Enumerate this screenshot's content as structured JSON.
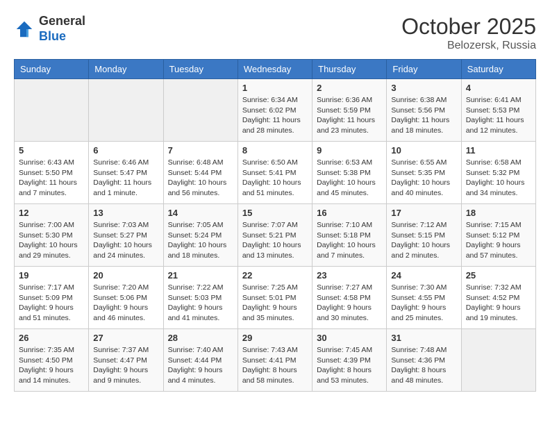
{
  "header": {
    "logo_general": "General",
    "logo_blue": "Blue",
    "title": "October 2025",
    "subtitle": "Belozersk, Russia"
  },
  "weekdays": [
    "Sunday",
    "Monday",
    "Tuesday",
    "Wednesday",
    "Thursday",
    "Friday",
    "Saturday"
  ],
  "weeks": [
    [
      {
        "day": "",
        "info": ""
      },
      {
        "day": "",
        "info": ""
      },
      {
        "day": "",
        "info": ""
      },
      {
        "day": "1",
        "info": "Sunrise: 6:34 AM\nSunset: 6:02 PM\nDaylight: 11 hours and 28 minutes."
      },
      {
        "day": "2",
        "info": "Sunrise: 6:36 AM\nSunset: 5:59 PM\nDaylight: 11 hours and 23 minutes."
      },
      {
        "day": "3",
        "info": "Sunrise: 6:38 AM\nSunset: 5:56 PM\nDaylight: 11 hours and 18 minutes."
      },
      {
        "day": "4",
        "info": "Sunrise: 6:41 AM\nSunset: 5:53 PM\nDaylight: 11 hours and 12 minutes."
      }
    ],
    [
      {
        "day": "5",
        "info": "Sunrise: 6:43 AM\nSunset: 5:50 PM\nDaylight: 11 hours and 7 minutes."
      },
      {
        "day": "6",
        "info": "Sunrise: 6:46 AM\nSunset: 5:47 PM\nDaylight: 11 hours and 1 minute."
      },
      {
        "day": "7",
        "info": "Sunrise: 6:48 AM\nSunset: 5:44 PM\nDaylight: 10 hours and 56 minutes."
      },
      {
        "day": "8",
        "info": "Sunrise: 6:50 AM\nSunset: 5:41 PM\nDaylight: 10 hours and 51 minutes."
      },
      {
        "day": "9",
        "info": "Sunrise: 6:53 AM\nSunset: 5:38 PM\nDaylight: 10 hours and 45 minutes."
      },
      {
        "day": "10",
        "info": "Sunrise: 6:55 AM\nSunset: 5:35 PM\nDaylight: 10 hours and 40 minutes."
      },
      {
        "day": "11",
        "info": "Sunrise: 6:58 AM\nSunset: 5:32 PM\nDaylight: 10 hours and 34 minutes."
      }
    ],
    [
      {
        "day": "12",
        "info": "Sunrise: 7:00 AM\nSunset: 5:30 PM\nDaylight: 10 hours and 29 minutes."
      },
      {
        "day": "13",
        "info": "Sunrise: 7:03 AM\nSunset: 5:27 PM\nDaylight: 10 hours and 24 minutes."
      },
      {
        "day": "14",
        "info": "Sunrise: 7:05 AM\nSunset: 5:24 PM\nDaylight: 10 hours and 18 minutes."
      },
      {
        "day": "15",
        "info": "Sunrise: 7:07 AM\nSunset: 5:21 PM\nDaylight: 10 hours and 13 minutes."
      },
      {
        "day": "16",
        "info": "Sunrise: 7:10 AM\nSunset: 5:18 PM\nDaylight: 10 hours and 7 minutes."
      },
      {
        "day": "17",
        "info": "Sunrise: 7:12 AM\nSunset: 5:15 PM\nDaylight: 10 hours and 2 minutes."
      },
      {
        "day": "18",
        "info": "Sunrise: 7:15 AM\nSunset: 5:12 PM\nDaylight: 9 hours and 57 minutes."
      }
    ],
    [
      {
        "day": "19",
        "info": "Sunrise: 7:17 AM\nSunset: 5:09 PM\nDaylight: 9 hours and 51 minutes."
      },
      {
        "day": "20",
        "info": "Sunrise: 7:20 AM\nSunset: 5:06 PM\nDaylight: 9 hours and 46 minutes."
      },
      {
        "day": "21",
        "info": "Sunrise: 7:22 AM\nSunset: 5:03 PM\nDaylight: 9 hours and 41 minutes."
      },
      {
        "day": "22",
        "info": "Sunrise: 7:25 AM\nSunset: 5:01 PM\nDaylight: 9 hours and 35 minutes."
      },
      {
        "day": "23",
        "info": "Sunrise: 7:27 AM\nSunset: 4:58 PM\nDaylight: 9 hours and 30 minutes."
      },
      {
        "day": "24",
        "info": "Sunrise: 7:30 AM\nSunset: 4:55 PM\nDaylight: 9 hours and 25 minutes."
      },
      {
        "day": "25",
        "info": "Sunrise: 7:32 AM\nSunset: 4:52 PM\nDaylight: 9 hours and 19 minutes."
      }
    ],
    [
      {
        "day": "26",
        "info": "Sunrise: 7:35 AM\nSunset: 4:50 PM\nDaylight: 9 hours and 14 minutes."
      },
      {
        "day": "27",
        "info": "Sunrise: 7:37 AM\nSunset: 4:47 PM\nDaylight: 9 hours and 9 minutes."
      },
      {
        "day": "28",
        "info": "Sunrise: 7:40 AM\nSunset: 4:44 PM\nDaylight: 9 hours and 4 minutes."
      },
      {
        "day": "29",
        "info": "Sunrise: 7:43 AM\nSunset: 4:41 PM\nDaylight: 8 hours and 58 minutes."
      },
      {
        "day": "30",
        "info": "Sunrise: 7:45 AM\nSunset: 4:39 PM\nDaylight: 8 hours and 53 minutes."
      },
      {
        "day": "31",
        "info": "Sunrise: 7:48 AM\nSunset: 4:36 PM\nDaylight: 8 hours and 48 minutes."
      },
      {
        "day": "",
        "info": ""
      }
    ]
  ]
}
